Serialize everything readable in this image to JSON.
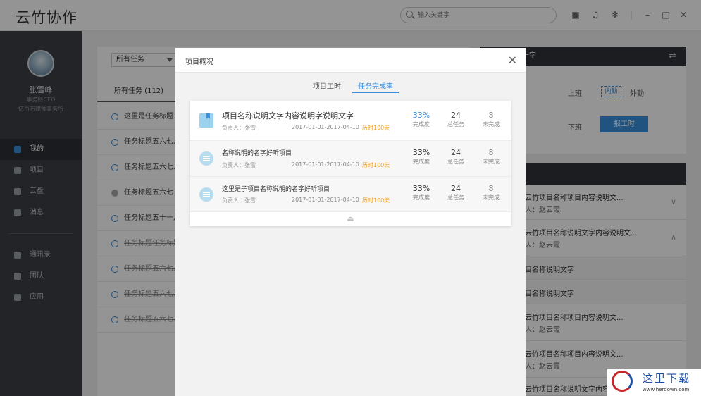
{
  "app": {
    "title": "云竹协作"
  },
  "search": {
    "placeholder": "输入关键字"
  },
  "topbar": {
    "icons": [
      "briefcase-icon",
      "bell-icon",
      "gear-icon",
      "minimize-icon",
      "maximize-icon",
      "close-icon"
    ]
  },
  "user": {
    "name": "张雪峰",
    "title_line1": "事务所CEO",
    "title_line2": "亿百万律师事务所"
  },
  "sidebar": {
    "items": [
      {
        "label": "我的",
        "icon": "user-icon",
        "active": true
      },
      {
        "label": "项目",
        "icon": "project-icon"
      },
      {
        "label": "云盘",
        "icon": "cloud-icon"
      },
      {
        "label": "消息",
        "icon": "message-icon"
      },
      {
        "label": "通讯录",
        "icon": "contacts-icon"
      },
      {
        "label": "团队",
        "icon": "flag-icon"
      },
      {
        "label": "应用",
        "icon": "apps-icon"
      }
    ]
  },
  "task_list": {
    "filter": "所有任务",
    "tab": "所有任务 (112)",
    "items": [
      {
        "title": "这里是任务标题",
        "state": "open"
      },
      {
        "title": "任务标题五六七八",
        "state": "open"
      },
      {
        "title": "任务标题五六七八",
        "state": "open"
      },
      {
        "title": "任务标题五六七",
        "state": "done"
      },
      {
        "title": "任务标题五十一月",
        "state": "open"
      },
      {
        "title": "任务标题任务标题",
        "state": "struck"
      },
      {
        "title": "任务标题五六七八",
        "state": "struck"
      },
      {
        "title": "任务标题五六七八",
        "state": "struck"
      },
      {
        "title": "任务标题五六七八",
        "state": "struck"
      }
    ]
  },
  "attendance": {
    "header": "十字",
    "on_label": "上班",
    "off_label": "下班",
    "inner": "内勤",
    "outer": "外勤",
    "report_button": "报工时"
  },
  "right_list": {
    "items": [
      {
        "line1": "云竹项目名称项目内容说明文...",
        "line2": "人：赵云霞",
        "chevron": "down"
      },
      {
        "line1": "云竹项目名称说明文字内容说明文...",
        "line2": "人：赵云霞",
        "chevron": "up"
      },
      {
        "line1": "目名称说明文字"
      },
      {
        "line1": "目名称说明文字"
      },
      {
        "line1": "云竹项目名称项目内容说明文...",
        "line2": "人：赵云霞"
      },
      {
        "line1": "云竹项目名称项目内容说明文...",
        "line2": "人：赵云霞"
      },
      {
        "line1": "云竹项目名称说明文字内容..."
      }
    ]
  },
  "modal": {
    "title": "项目概况",
    "tabs": [
      {
        "label": "项目工时"
      },
      {
        "label": "任务完成率",
        "active": true
      }
    ],
    "projects": [
      {
        "name": "项目名称说明文字内容说明字说明文字",
        "owner": "负责人：张雪",
        "dates": "2017-01-01-2017-04-10",
        "duration": "历时100天",
        "pct": "33%",
        "pct_label": "完成度",
        "total": "24",
        "total_label": "总任务",
        "pending": "8",
        "pending_label": "未完成",
        "icon": "book-icon"
      },
      {
        "name": "名称说明的名字好听项目",
        "owner": "负责人：张雪",
        "dates": "2017-01-01-2017-04-10",
        "duration": "历时100天",
        "pct": "33%",
        "pct_label": "完成度",
        "total": "24",
        "total_label": "总任务",
        "pending": "8",
        "pending_label": "未完成",
        "icon": "list-icon"
      },
      {
        "name": "这里是子项目名称说明的名字好听项目",
        "owner": "负责人：张雪",
        "dates": "2017-01-01-2017-04-10",
        "duration": "历时100天",
        "pct": "33%",
        "pct_label": "完成度",
        "total": "24",
        "total_label": "总任务",
        "pending": "8",
        "pending_label": "未完成",
        "icon": "list-icon"
      }
    ]
  },
  "watermark": {
    "line1": "这里下载",
    "line2": "www.herdown.com"
  }
}
